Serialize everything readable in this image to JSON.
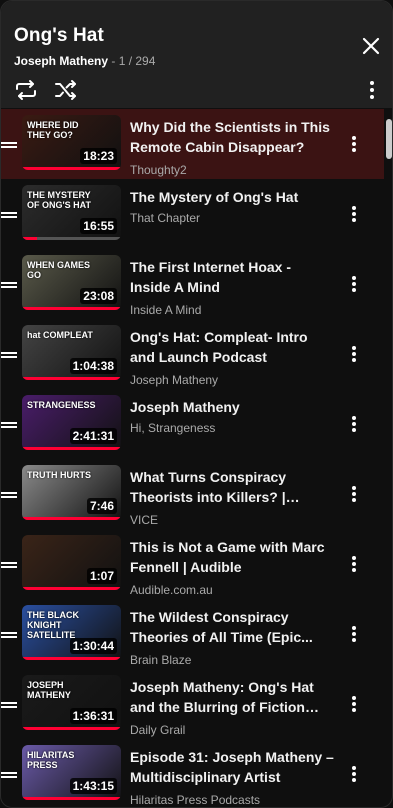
{
  "playlist": {
    "title": "Ong's Hat",
    "owner": "Joseph Matheny",
    "separator": " - ",
    "position": "1 / 294"
  },
  "colors": {
    "accent": "#ff0033",
    "active_row": "#3b1313",
    "background": "#0f0f0f",
    "header": "#212121"
  },
  "icons": {
    "close": "close-icon",
    "loop": "loop-icon",
    "shuffle": "shuffle-icon",
    "menu": "more-vert-icon"
  },
  "videos": [
    {
      "title": "Why Did the Scientists in This Remote Cabin Disappear?",
      "channel": "Thoughty2",
      "duration": "18:23",
      "thumb_text": "WHERE DID THEY GO?",
      "thumb_bg": "#3a1a12",
      "watched": 1.0
    },
    {
      "title": "The Mystery of Ong's Hat",
      "channel": "That Chapter",
      "duration": "16:55",
      "thumb_text": "THE MYSTERY OF ONG'S HAT",
      "thumb_bg": "#2c2c2c",
      "watched": 0.15
    },
    {
      "title": "The First Internet Hoax - Inside A Mind",
      "channel": "Inside A Mind",
      "duration": "23:08",
      "thumb_text": "WHEN GAMES GO",
      "thumb_bg": "#5a5a4a",
      "watched": 1.0
    },
    {
      "title": "Ong's Hat: Compleat- Intro and Launch Podcast",
      "channel": "Joseph Matheny",
      "duration": "1:04:38",
      "thumb_text": "hat COMPLEAT",
      "thumb_bg": "#444444",
      "watched": 1.0
    },
    {
      "title": "Joseph Matheny",
      "channel": "Hi, Strangeness",
      "duration": "2:41:31",
      "thumb_text": "STRANGENESS",
      "thumb_bg": "#4a1d6a",
      "watched": 1.0
    },
    {
      "title": "What Turns Conspiracy Theorists into Killers? | Truth...",
      "channel": "VICE",
      "duration": "7:46",
      "thumb_text": "TRUTH HURTS",
      "thumb_bg": "#8a8a8a",
      "watched": 1.0
    },
    {
      "title": "This is Not a Game with Marc Fennell | Audible",
      "channel": "Audible.com.au",
      "duration": "1:07",
      "thumb_text": "",
      "thumb_bg": "#3a2418",
      "watched": 1.0
    },
    {
      "title": "The Wildest Conspiracy Theories of All Time (Epic...",
      "channel": "Brain Blaze",
      "duration": "1:30:44",
      "thumb_text": "THE BLACK KNIGHT SATELLITE",
      "thumb_bg": "#2a4fa0",
      "watched": 1.0
    },
    {
      "title": "Joseph Matheny: Ong's Hat and the Blurring of Fiction an...",
      "channel": "Daily Grail",
      "duration": "1:36:31",
      "thumb_text": "JOSEPH MATHENY",
      "thumb_bg": "#1a1a1a",
      "watched": 1.0
    },
    {
      "title": "Episode 31: Joseph Matheny – Multidisciplinary Artist",
      "channel": "Hilaritas Press Podcasts",
      "duration": "1:43:15",
      "thumb_text": "HILARITAS PRESS",
      "thumb_bg": "#6a5aa8",
      "watched": 1.0
    }
  ]
}
